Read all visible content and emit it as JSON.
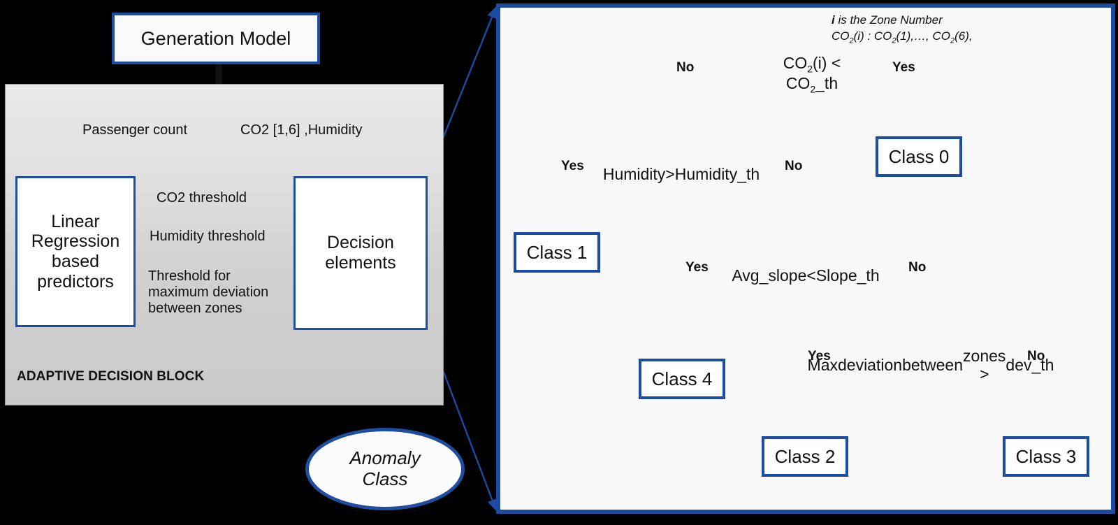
{
  "left": {
    "generation_model": "Generation Model",
    "block_label": "ADAPTIVE DECISION BLOCK",
    "linear_regression": "Linear\nRegression\nbased\npredictors",
    "decision_elements": "Decision\nelements",
    "anomaly_class": "Anomaly\nClass",
    "edges": {
      "passenger_count": "Passenger count",
      "co2_humidity": "CO2 [1,6] ,Humidity",
      "co2_threshold": "CO2 threshold",
      "humidity_threshold": "Humidity threshold",
      "max_deviation": "Threshold for maximum deviation between zones"
    }
  },
  "panel": {
    "legend_line1_em": "i",
    "legend_line1_rest": " is the Zone Number",
    "legend_line2_a": "CO",
    "legend_line2_sub1": "2",
    "legend_line2_b": "(i) : CO",
    "legend_line2_sub2": "2",
    "legend_line2_c": "(1),…, CO",
    "legend_line2_sub3": "2",
    "legend_line2_d": "(6),",
    "decisions": [
      {
        "id": "co2-check",
        "line1_a": "CO",
        "line1_sub": "2",
        "line1_b": "(i) <",
        "line2_a": "CO",
        "line2_sub": "2",
        "line2_b": "_th",
        "yes_label": "Yes",
        "no_label": "No"
      },
      {
        "id": "humidity-check",
        "lines": "Humidity\n>\nHumidity_\nth",
        "yes_label": "Yes",
        "no_label": "No"
      },
      {
        "id": "avg-slope-check",
        "lines": "Avg_slope\n<\nSlope_th",
        "yes_label": "Yes",
        "no_label": "No"
      },
      {
        "id": "max-deviation-check",
        "lines": "Max\ndeviation\nbetween\nzones >\ndev_th",
        "yes_label": "Yes",
        "no_label": "No"
      }
    ],
    "classes": [
      {
        "id": "class-0",
        "label": "Class 0"
      },
      {
        "id": "class-1",
        "label": "Class 1"
      },
      {
        "id": "class-4",
        "label": "Class 4"
      },
      {
        "id": "class-2",
        "label": "Class 2"
      },
      {
        "id": "class-3",
        "label": "Class 3"
      }
    ]
  },
  "colors": {
    "accent_blue": "#1b4ba3",
    "panel_bg": "#f8f8f8",
    "block_gray": "#d2d2d2",
    "background": "#000000"
  }
}
